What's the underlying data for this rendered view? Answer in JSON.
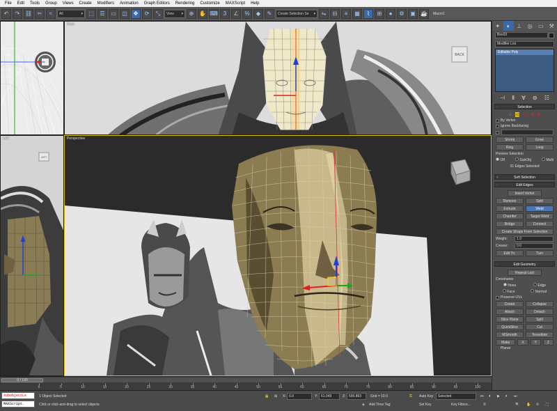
{
  "menu": [
    "File",
    "Edit",
    "Tools",
    "Group",
    "Views",
    "Create",
    "Modifiers",
    "Animation",
    "Graph Editors",
    "Rendering",
    "Customize",
    "MAXScript",
    "Help"
  ],
  "toolbar": {
    "filter_value": "All",
    "refcoord_value": "View",
    "named_selection_placeholder": "Create Selection Se",
    "macro_label": "Macro1"
  },
  "viewports": {
    "top_left_label": "",
    "back_label": "Back",
    "left_label": "Left",
    "perspective_label": "Perspective",
    "viewcube_back": "BACK",
    "viewcube_left": "LEFT"
  },
  "command_panel": {
    "object_name": "Box03",
    "modifier_list_label": "Modifier List",
    "stack_item": "Editable Poly",
    "selection": {
      "title": "Selection",
      "by_vertex": "By Vertex",
      "ignore_backfacing": "Ignore Backfacing",
      "shrink": "Shrink",
      "grow": "Grow",
      "ring": "Ring",
      "loop": "Loop",
      "preview_label": "Preview Selection",
      "preview_off": "Off",
      "preview_subobj": "SubObj",
      "preview_multi": "Multi",
      "status": "31 Edges Selected"
    },
    "soft_selection_title": "Soft Selection",
    "edit_edges": {
      "title": "Edit Edges",
      "insert_vertex": "Insert Vertex",
      "remove": "Remove",
      "split": "Split",
      "extrude": "Extrude",
      "weld": "Weld",
      "chamfer": "Chamfer",
      "target_weld": "Target Weld",
      "bridge": "Bridge",
      "connect": "Connect",
      "create_shape": "Create Shape From Selection",
      "weight_label": "Weight:",
      "weight_value": "1.0",
      "crease_label": "Crease:",
      "crease_value": "0.0",
      "edit_tri": "Edit Tri.",
      "turn": "Turn"
    },
    "edit_geometry": {
      "title": "Edit Geometry",
      "repeat_last": "Repeat Last",
      "constraints_label": "Constraints",
      "c_none": "None",
      "c_edge": "Edge",
      "c_face": "Face",
      "c_normal": "Normal",
      "preserve_uvs": "Preserve UVs",
      "create": "Create",
      "collapse": "Collapse",
      "attach": "Attach",
      "detach": "Detach",
      "slice_plane": "Slice Plane",
      "split": "Split",
      "quickslice": "QuickSlice",
      "cut": "Cut",
      "msmooth": "MSmooth",
      "tessellate": "Tessellate",
      "make_planar": "Make Planar",
      "x": "X",
      "y": "Y",
      "z": "Z"
    }
  },
  "timeline": {
    "frame_display": "0 / 100",
    "ticks": [
      0,
      5,
      10,
      15,
      20,
      25,
      30,
      35,
      40,
      45,
      50,
      55,
      60,
      65,
      70,
      75,
      80,
      85,
      90,
      95,
      100
    ]
  },
  "status": {
    "listener_line1": "subobjectLe",
    "listener_line2": "MAXScript.",
    "selected_count": "1 Object Selected",
    "prompt": "Click or click-and-drag to select objects",
    "x_label": "X:",
    "x_value": "0.0",
    "y_label": "Y:",
    "y_value": "61.049",
    "z_label": "Z:",
    "z_value": "599.863",
    "grid": "Grid = 10.0",
    "add_time_tag": "Add Time Tag",
    "auto_key": "Auto Key",
    "selected_dropdown": "Selected",
    "set_key": "Set Key",
    "key_filters": "Key Filters..."
  }
}
